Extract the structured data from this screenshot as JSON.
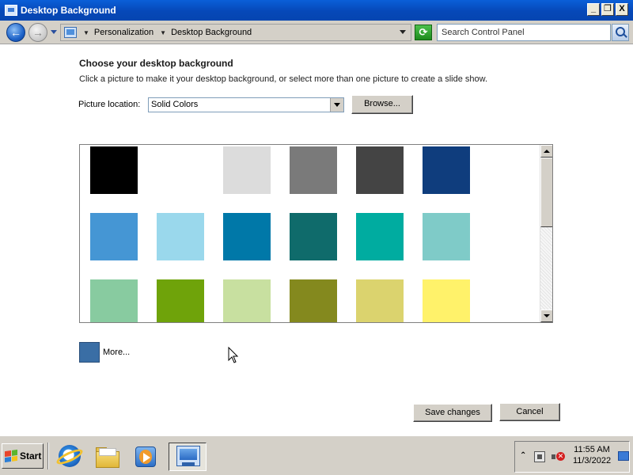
{
  "window": {
    "title": "Desktop Background",
    "controls": {
      "minimize": "_",
      "restore": "❐",
      "close": "X"
    }
  },
  "addressbar": {
    "breadcrumb": [
      "Personalization",
      "Desktop Background"
    ],
    "search_placeholder": "Search Control Panel"
  },
  "main": {
    "heading": "Choose your desktop background",
    "subtext": "Click a picture to make it your desktop background, or select more than one picture to create a slide show.",
    "location_label": "Picture location:",
    "location_value": "Solid Colors",
    "browse_label": "Browse...",
    "more_label": "More...",
    "more_color": "#3a6ea5",
    "save_label": "Save changes",
    "cancel_label": "Cancel"
  },
  "swatches": [
    [
      "#000000",
      "#ffffff",
      "#dcdcdc",
      "#7a7a7a",
      "#444444",
      "#0f3d7d"
    ],
    [
      "#4596d4",
      "#9ad8ec",
      "#0078a8",
      "#0f6b6b",
      "#00aca0",
      "#7fcbc8"
    ],
    [
      "#88cba0",
      "#6fa30a",
      "#c8e0a0",
      "#84891e",
      "#dbd36e",
      "#fff26a"
    ]
  ],
  "taskbar": {
    "start_label": "Start",
    "time": "11:55 AM",
    "date": "11/3/2022"
  }
}
